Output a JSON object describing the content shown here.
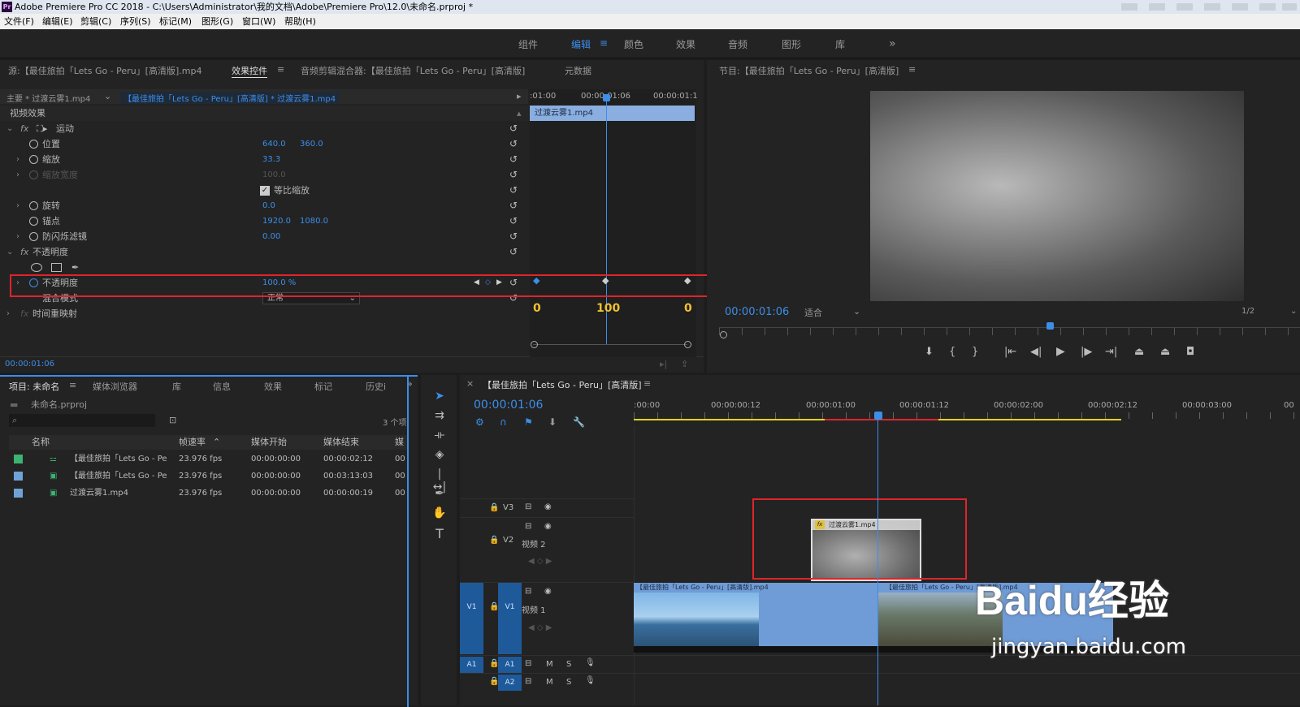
{
  "app": {
    "title": "Adobe Premiere Pro CC 2018 - C:\\Users\\Administrator\\我的文档\\Adobe\\Premiere Pro\\12.0\\未命名.prproj *",
    "logo": "Pr"
  },
  "menu": [
    "文件(F)",
    "编辑(E)",
    "剪辑(C)",
    "序列(S)",
    "标记(M)",
    "图形(G)",
    "窗口(W)",
    "帮助(H)"
  ],
  "workspaces": {
    "items": [
      "组件",
      "编辑",
      "颜色",
      "效果",
      "音频",
      "图形",
      "库"
    ],
    "active": "编辑",
    "more": "»"
  },
  "source_tabs": {
    "source": "源:【最佳旅拍「Lets Go - Peru」[高清版].mp4",
    "effect_controls": "效果控件",
    "audio_mixer": "音频剪辑混合器:【最佳旅拍「Lets Go - Peru」[高清版]",
    "metadata": "元数据"
  },
  "effect_controls": {
    "master": "主要 * 过渡云雾1.mp4",
    "sequence_clip": "【最佳旅拍「Lets Go - Peru」[高清版] * 过渡云雾1.mp4",
    "video_effects": "视频效果",
    "motion": "运动",
    "position": "位置",
    "pos_x": "640.0",
    "pos_y": "360.0",
    "scale": "缩放",
    "scale_val": "33.3",
    "scale_width": "缩放宽度",
    "scale_width_val": "100.0",
    "uniform_scale": "等比缩放",
    "rotation": "旋转",
    "rotation_val": "0.0",
    "anchor": "锚点",
    "anchor_x": "1920.0",
    "anchor_y": "1080.0",
    "antiflicker": "防闪烁滤镜",
    "antiflicker_val": "0.00",
    "opacity_section": "不透明度",
    "opacity": "不透明度",
    "opacity_val": "100.0 %",
    "blend_mode": "混合模式",
    "blend_val": "正常",
    "time_remap": "时间重映射",
    "timecode": "00:00:01:06",
    "ruler": [
      ":01:00",
      "00:00:01:06",
      "00:00:01:1"
    ],
    "clip_label": "过渡云雾1.mp4",
    "kf_values": [
      "0",
      "100",
      "0"
    ]
  },
  "program": {
    "title": "节目:【最佳旅拍「Lets Go - Peru」[高清版]",
    "timecode": "00:00:01:06",
    "fit": "适合",
    "resolution": "1/2"
  },
  "project": {
    "tabs": [
      "项目: 未命名",
      "媒体浏览器",
      "库",
      "信息",
      "效果",
      "标记",
      "历史i"
    ],
    "file": "未命名.prproj",
    "count": "3 个项",
    "columns": [
      "名称",
      "帧速率",
      "媒体开始",
      "媒体结束",
      "媒"
    ],
    "rows": [
      {
        "color": "#3cb371",
        "name": "【最佳旅拍「Lets Go - Pe",
        "fps": "23.976 fps",
        "start": "00:00:00:00",
        "end": "00:00:02:12",
        "m": "00"
      },
      {
        "color": "#6fa3d8",
        "name": "【最佳旅拍「Lets Go - Pe",
        "fps": "23.976 fps",
        "start": "00:00:00:00",
        "end": "00:03:13:03",
        "m": "00"
      },
      {
        "color": "#6fa3d8",
        "name": "过渡云雾1.mp4",
        "fps": "23.976 fps",
        "start": "00:00:00:00",
        "end": "00:00:00:19",
        "m": "00"
      }
    ]
  },
  "timeline": {
    "title": "【最佳旅拍「Lets Go - Peru」[高清版]",
    "timecode": "00:00:01:06",
    "ruler": [
      ":00:00",
      "00:00:00:12",
      "00:00:01:00",
      "00:00:01:12",
      "00:00:02:00",
      "00:00:02:12",
      "00:00:03:00",
      "00"
    ],
    "tracks": {
      "v3": "V3",
      "v2": "V2",
      "v2_name": "视频 2",
      "v1": "V1",
      "v1_name": "视频 1",
      "a1": "A1",
      "a2": "A2",
      "m": "M",
      "s": "S"
    },
    "clip_v2": "过渡云雾1.mp4",
    "clip_v1a": "【最佳旅拍「Lets Go - Peru」[高清版].mp4",
    "clip_v1b": "【最佳旅拍「Lets Go - Peru」[高清版].mp4"
  },
  "watermark": {
    "brand": "Baidu经验",
    "url": "jingyan.baidu.com"
  }
}
